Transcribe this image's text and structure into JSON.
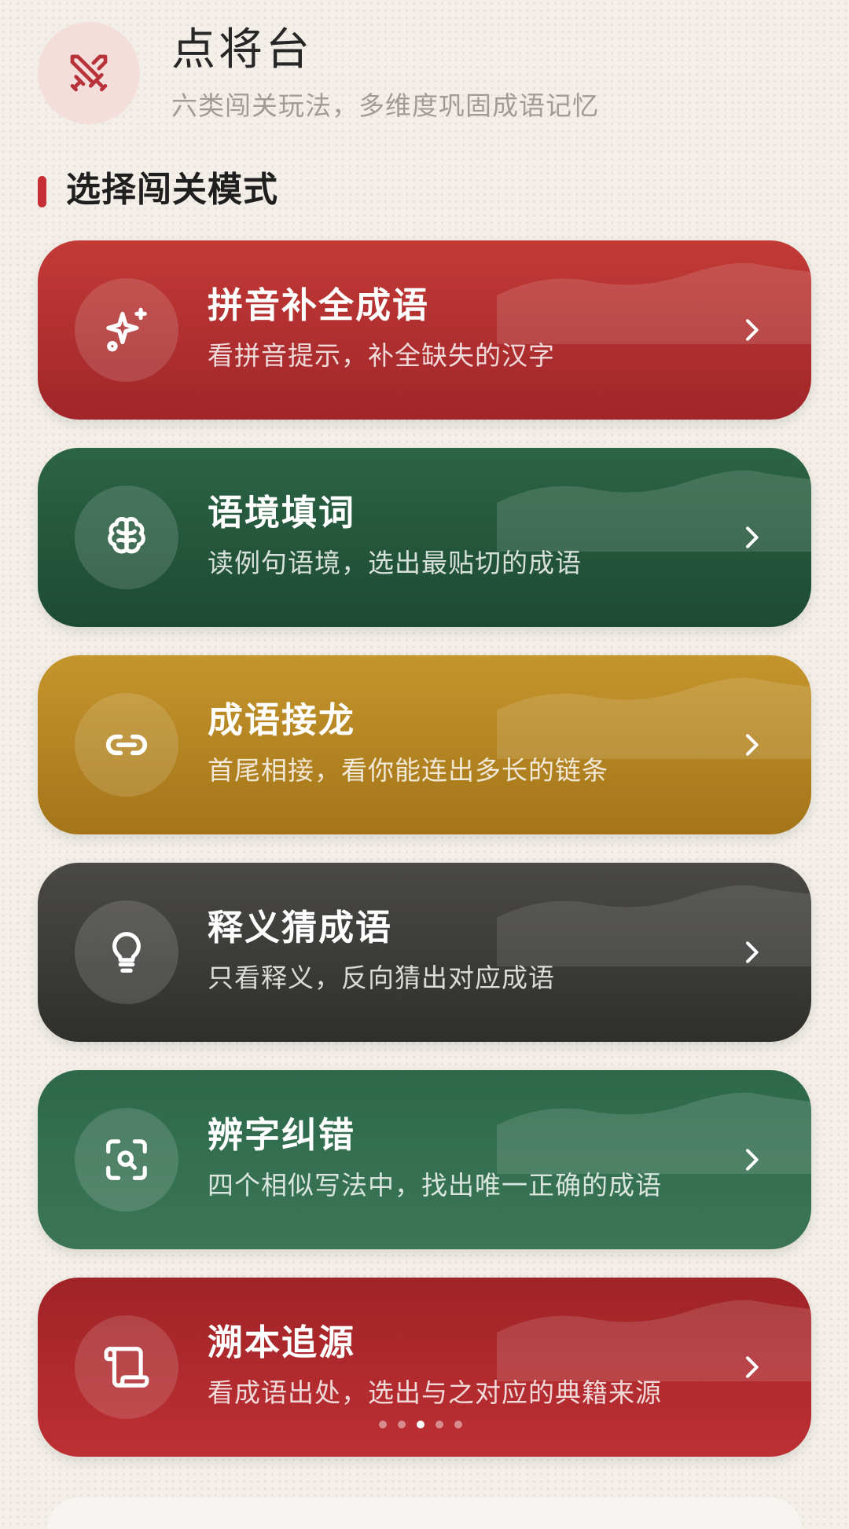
{
  "header": {
    "title": "点将台",
    "subtitle": "六类闯关玩法，多维度巩固成语记忆",
    "logo_icon": "crossed-swords-icon"
  },
  "section": {
    "title": "选择闯关模式"
  },
  "modes": [
    {
      "title": "拼音补全成语",
      "desc": "看拼音提示，补全缺失的汉字",
      "icon": "sparkles-icon",
      "color": "#b5302f"
    },
    {
      "title": "语境填词",
      "desc": "读例句语境，选出最贴切的成语",
      "icon": "brain-icon",
      "color": "#255a3e"
    },
    {
      "title": "成语接龙",
      "desc": "首尾相接，看你能连出多长的链条",
      "icon": "link-icon",
      "color": "#b88624"
    },
    {
      "title": "释义猜成语",
      "desc": "只看释义，反向猜出对应成语",
      "icon": "lightbulb-icon",
      "color": "#3c3c39"
    },
    {
      "title": "辨字纠错",
      "desc": "四个相似写法中，找出唯一正确的成语",
      "icon": "scan-search-icon",
      "color": "#327050"
    },
    {
      "title": "溯本追源",
      "desc": "看成语出处，选出与之对应的典籍来源",
      "icon": "scroll-icon",
      "color": "#ae292d"
    }
  ],
  "pagination": {
    "count": 5,
    "active_index": 2
  }
}
